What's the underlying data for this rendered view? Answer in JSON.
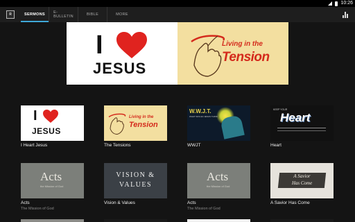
{
  "status": {
    "time": "10:26"
  },
  "toolbar": {
    "logo_text": "R",
    "tabs": [
      {
        "label": "SERMONS"
      },
      {
        "label": "E-BULLETIN"
      },
      {
        "label": "BIBLE"
      },
      {
        "label": "MORE"
      }
    ],
    "chart_icon": "bar-chart-icon"
  },
  "hero": {
    "left": {
      "line1": "I",
      "line2": "JESUS"
    },
    "right": {
      "line1": "Living in the",
      "line2": "Tension"
    }
  },
  "cards": [
    {
      "title": "I Heart Jesus",
      "subtitle": "",
      "thumb": {
        "line1": "I",
        "line2": "JESUS"
      }
    },
    {
      "title": "The Tensions",
      "subtitle": "",
      "thumb": {
        "line1": "Living in the",
        "line2": "Tension"
      }
    },
    {
      "title": "WWJT",
      "subtitle": "",
      "thumb": {
        "line1": "W.W.J.T.",
        "line2": "WHAT WOULD JESUS THINK"
      }
    },
    {
      "title": "Heart",
      "subtitle": "",
      "thumb": {
        "line1": "Heart",
        "line2": "KEEP YOUR"
      }
    },
    {
      "title": "Acts",
      "subtitle": "The Mission of God",
      "thumb": {
        "line1": "Acts",
        "line2": "the Mission of God"
      }
    },
    {
      "title": "Vision & Values",
      "subtitle": "",
      "thumb": {
        "line1": "VISION &",
        "line2": "VALUES"
      }
    },
    {
      "title": "Acts",
      "subtitle": "The Mission of God",
      "thumb": {
        "line1": "Acts",
        "line2": "the Mission of God"
      }
    },
    {
      "title": "A Savior Has Come",
      "subtitle": "",
      "thumb": {
        "line1": "A Savior",
        "line2": "Has Come"
      }
    }
  ],
  "colors": {
    "accent": "#3fa9d9",
    "heart": "#e0231f",
    "tension": "#d42a1c"
  }
}
